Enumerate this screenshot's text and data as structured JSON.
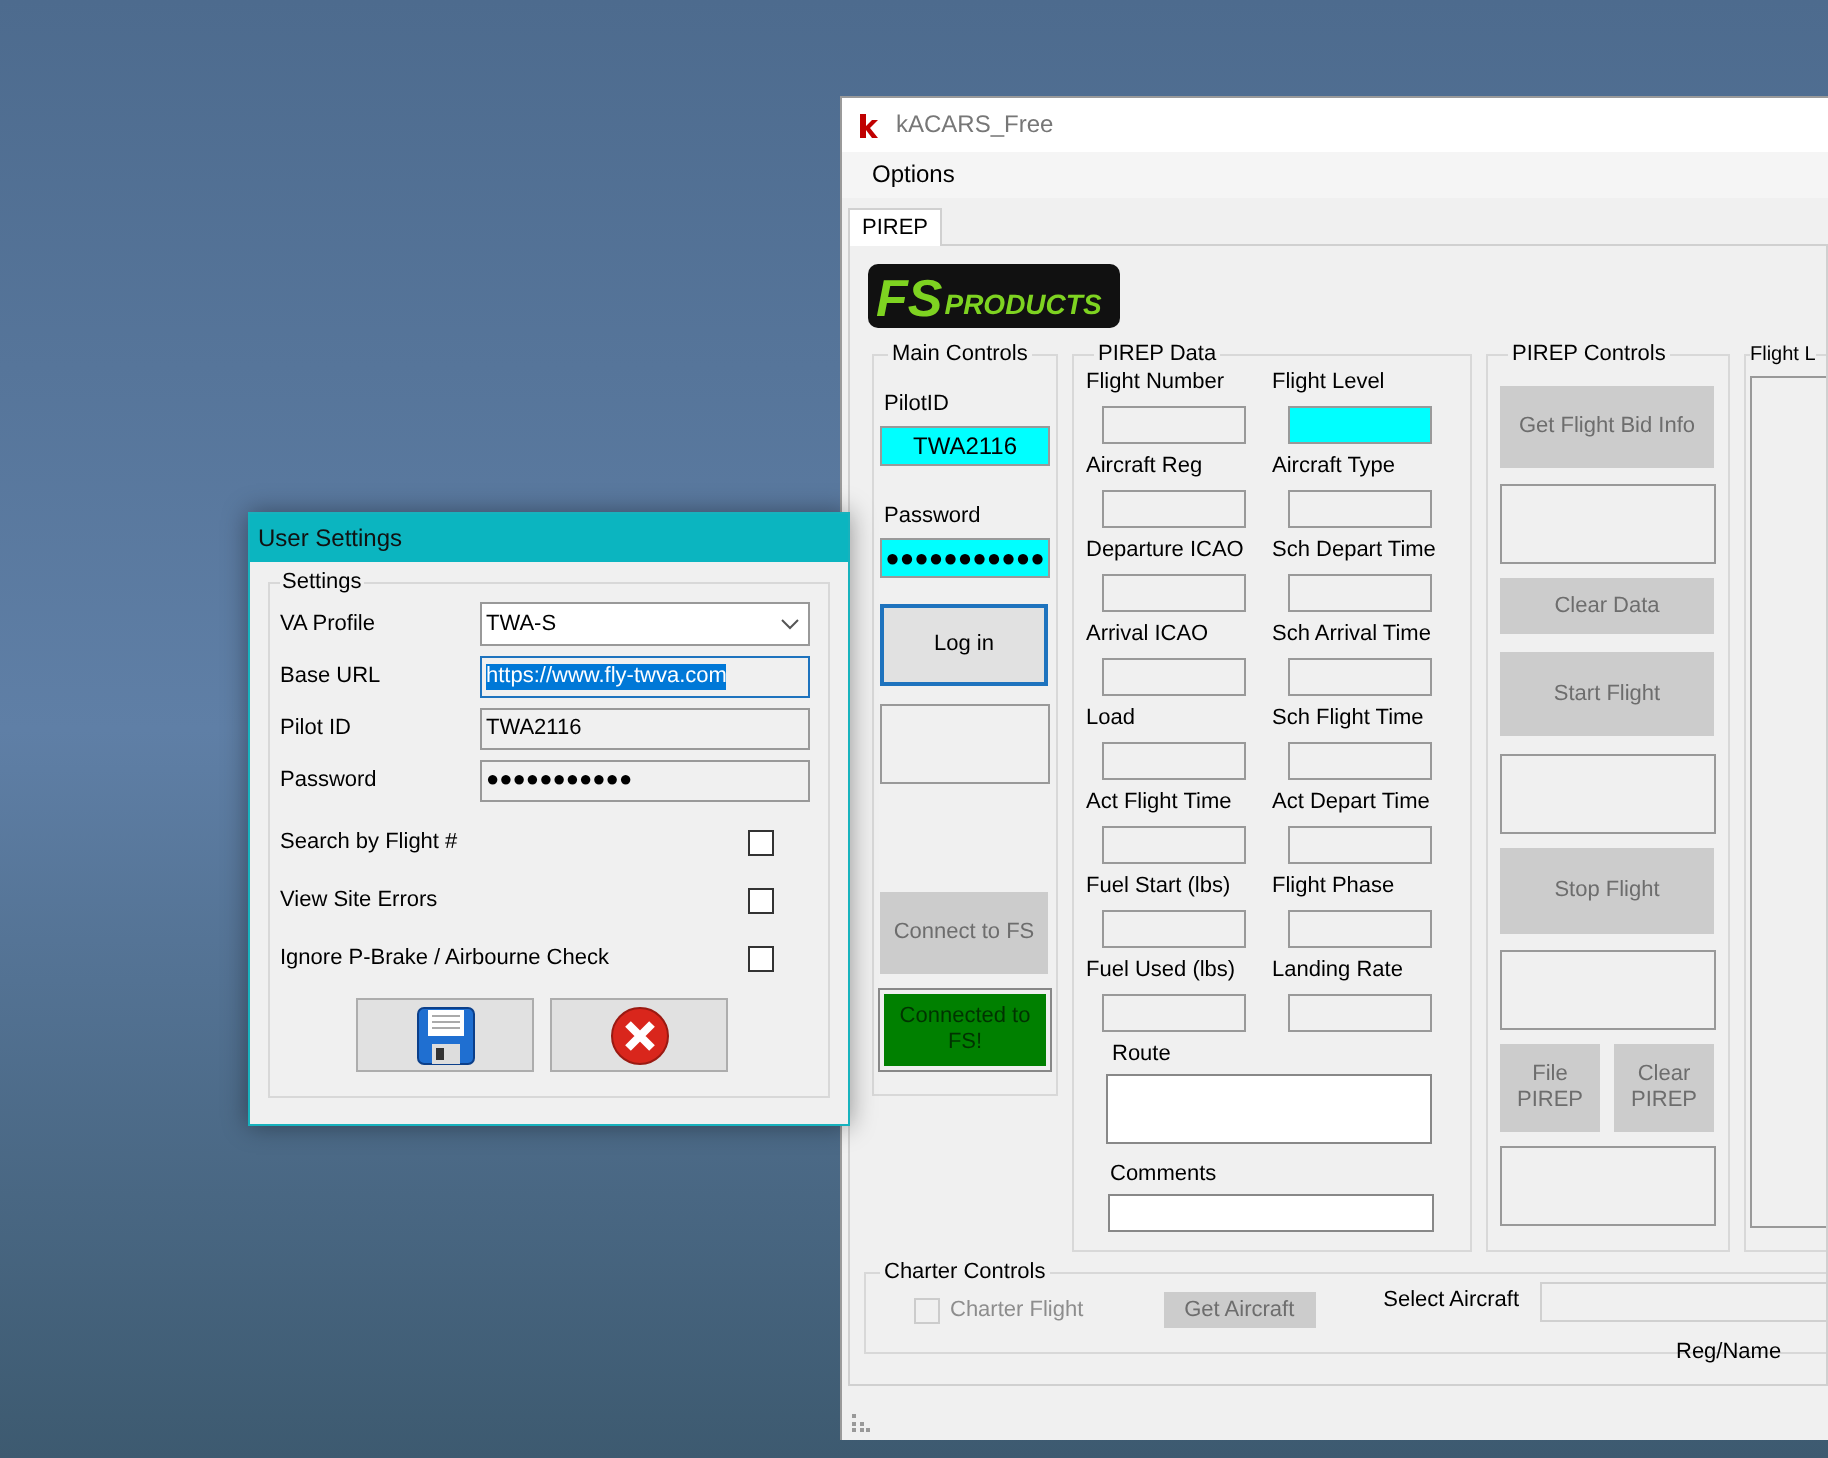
{
  "main_window": {
    "title": "kACARS_Free",
    "menu": [
      "Options"
    ],
    "tabs": [
      {
        "label": "PIREP",
        "selected": true
      }
    ],
    "logo": {
      "big": "FS",
      "small": "PRODUCTS"
    },
    "main_controls": {
      "title": "Main Controls",
      "fields": [
        {
          "label": "PilotID",
          "value": "TWA2116",
          "highlighted": true
        },
        {
          "label": "Password",
          "value": "●●●●●●●●●●●",
          "highlighted": true
        }
      ],
      "items": [
        {
          "kind": "button",
          "label": "Log in",
          "focused": true,
          "disabled": false
        },
        {
          "kind": "blank"
        },
        {
          "kind": "button",
          "label": "Connect to FS",
          "focused": false,
          "disabled": true
        },
        {
          "kind": "status",
          "label": "Connected to FS!",
          "color": "#008000"
        }
      ]
    },
    "pirep_data": {
      "title": "PIREP Data",
      "fields": [
        {
          "label": "Flight Number",
          "highlighted": false
        },
        {
          "label": "Flight Level",
          "highlighted": true
        },
        {
          "label": "Aircraft Reg",
          "highlighted": false
        },
        {
          "label": "Aircraft Type",
          "highlighted": false
        },
        {
          "label": "Departure ICAO",
          "highlighted": false
        },
        {
          "label": "Sch Depart Time",
          "highlighted": false
        },
        {
          "label": "Arrival ICAO",
          "highlighted": false
        },
        {
          "label": "Sch Arrival Time",
          "highlighted": false
        },
        {
          "label": "Load",
          "highlighted": false
        },
        {
          "label": "Sch Flight Time",
          "highlighted": false
        },
        {
          "label": "Act Flight Time",
          "highlighted": false
        },
        {
          "label": "Act Depart Time",
          "highlighted": false
        },
        {
          "label": "Fuel Start (lbs)",
          "highlighted": false
        },
        {
          "label": "Flight Phase",
          "highlighted": false
        },
        {
          "label": "Fuel Used (lbs)",
          "highlighted": false
        },
        {
          "label": "Landing Rate",
          "highlighted": false
        }
      ],
      "route": {
        "label": "Route"
      },
      "comments": {
        "label": "Comments"
      }
    },
    "pirep_controls": {
      "title": "PIREP Controls",
      "items": [
        {
          "kind": "button",
          "labels": [
            "Get Flight Bid Info"
          ],
          "disabled": true
        },
        {
          "kind": "blank"
        },
        {
          "kind": "button",
          "labels": [
            "Clear Data"
          ],
          "disabled": true
        },
        {
          "kind": "button",
          "labels": [
            "Start Flight"
          ],
          "disabled": true
        },
        {
          "kind": "blank"
        },
        {
          "kind": "button",
          "labels": [
            "Stop Flight"
          ],
          "disabled": true
        },
        {
          "kind": "blank"
        },
        {
          "kind": "pair",
          "labels": [
            "File PIREP",
            "Clear PIREP"
          ],
          "disabled": true
        },
        {
          "kind": "blank"
        }
      ]
    },
    "flight_log": {
      "title": "Flight L"
    },
    "charter_controls": {
      "title": "Charter Controls",
      "checkbox": {
        "label": "Charter Flight",
        "checked": false,
        "disabled": true
      },
      "button": {
        "label": "Get Aircraft",
        "disabled": true
      },
      "select_label": "Select Aircraft",
      "caption": "Reg/Name"
    }
  },
  "settings_dialog": {
    "title": "User Settings",
    "group": "Settings",
    "fields": [
      {
        "kind": "dropdown",
        "label": "VA Profile",
        "value": "TWA-S",
        "focused": false,
        "selected": false
      },
      {
        "kind": "text",
        "label": "Base URL",
        "value": "https://www.fly-twva.com",
        "focused": true,
        "selected": true
      },
      {
        "kind": "text",
        "label": "Pilot ID",
        "value": "TWA2116",
        "focused": false,
        "selected": false
      },
      {
        "kind": "text",
        "label": "Password",
        "value": "●●●●●●●●●●●",
        "focused": false,
        "selected": false
      }
    ],
    "checkboxes": [
      {
        "label": "Search by Flight #",
        "checked": false
      },
      {
        "label": "View Site Errors",
        "checked": false
      },
      {
        "label": "Ignore P-Brake / Airbourne Check",
        "checked": false
      }
    ],
    "buttons": [
      {
        "kind": "save"
      },
      {
        "kind": "cancel"
      }
    ]
  }
}
